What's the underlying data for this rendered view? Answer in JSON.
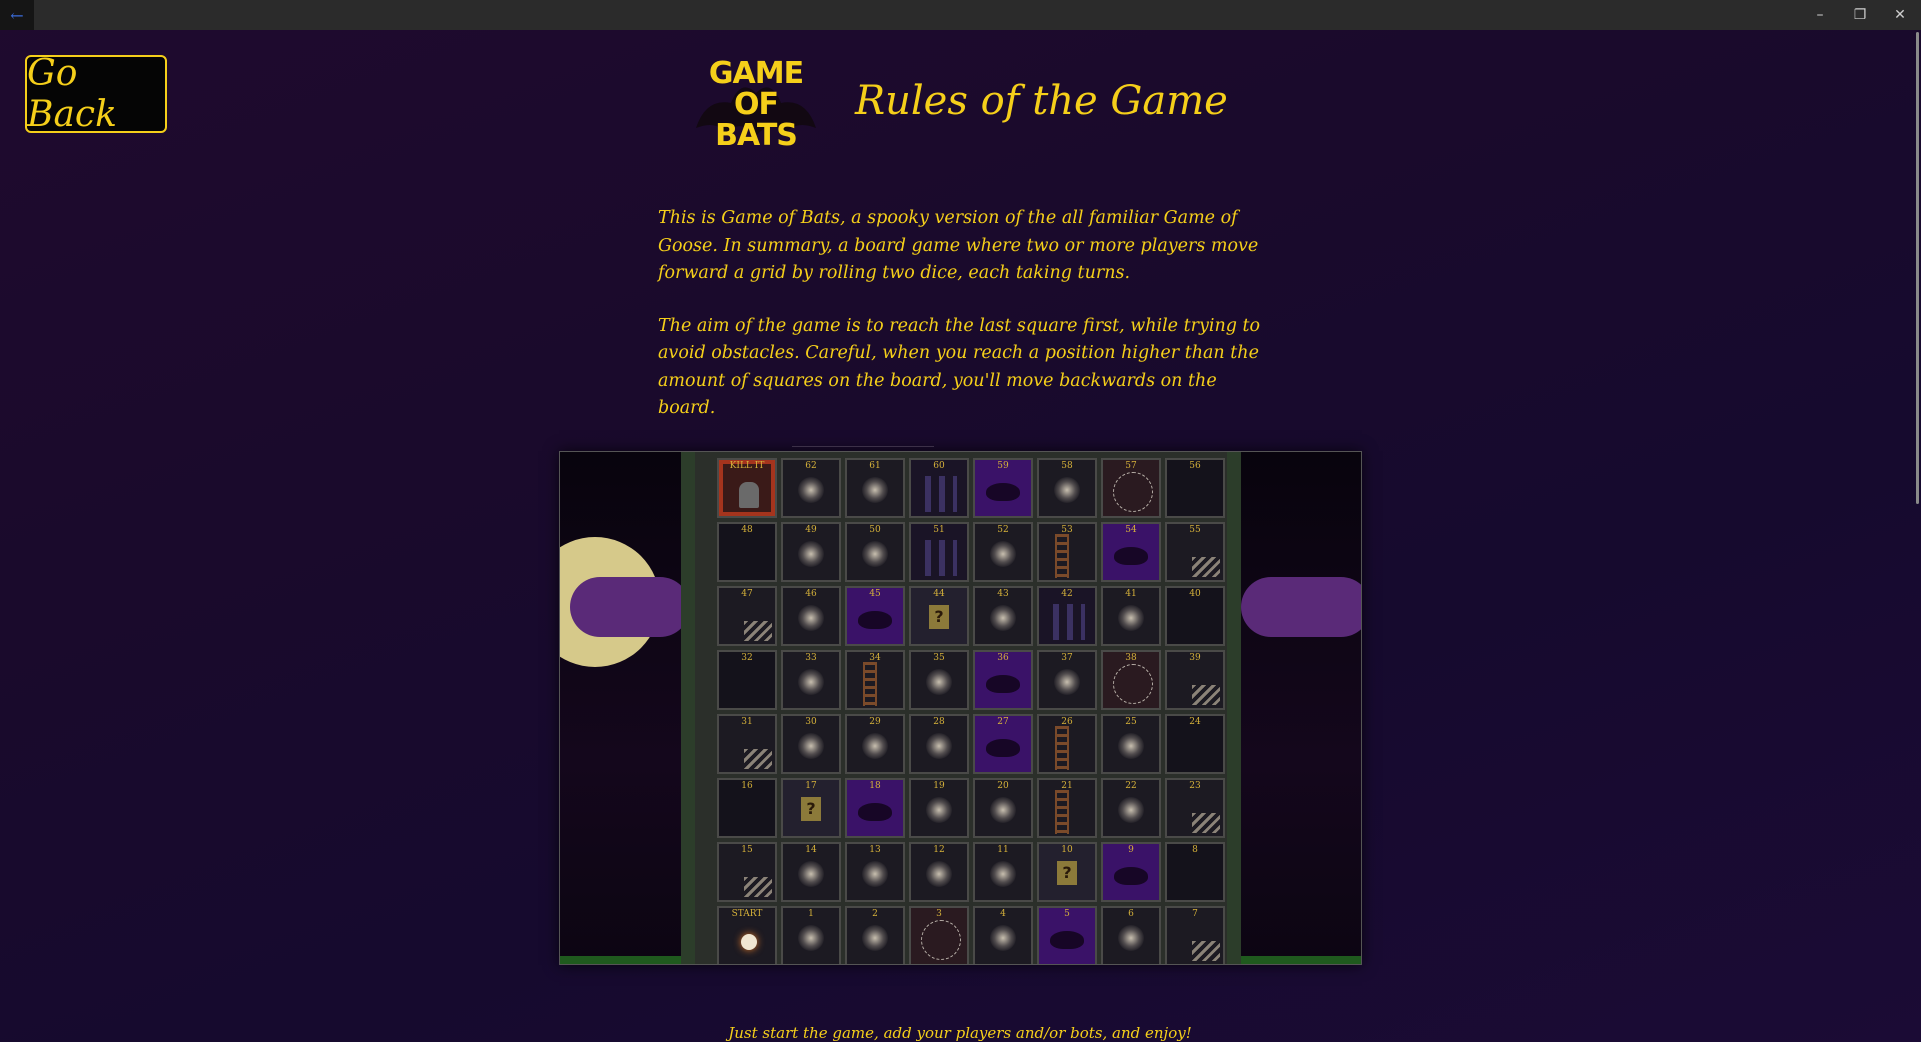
{
  "titlebar": {
    "back_glyph": "←",
    "minimize_glyph": "–",
    "restore_glyph": "❐",
    "close_glyph": "✕"
  },
  "go_back_label": "Go Back",
  "logo": {
    "line1": "GAME",
    "line2": "OF",
    "line3": "BATS"
  },
  "page_title": "Rules of the Game",
  "rules": {
    "paragraph1": "This is Game of Bats, a spooky version of the all familiar Game of Goose. In summary, a board game where two or more players move forward a grid by rolling two dice, each taking turns.",
    "paragraph2": "The aim of the game is to reach the last square first, while trying to avoid obstacles. Careful, when you reach a position higher than the amount of squares on the board, you'll move backwards on the board."
  },
  "board": {
    "rows": [
      [
        {
          "n": "KILL IT",
          "t": "kill"
        },
        {
          "n": "62",
          "t": "lamp"
        },
        {
          "n": "61",
          "t": "lamp"
        },
        {
          "n": "60",
          "t": "window"
        },
        {
          "n": "59",
          "t": "bat"
        },
        {
          "n": "58",
          "t": "lamp"
        },
        {
          "n": "57",
          "t": "web"
        },
        {
          "n": "56",
          "t": "dark"
        }
      ],
      [
        {
          "n": "48",
          "t": "dark"
        },
        {
          "n": "49",
          "t": "lamp"
        },
        {
          "n": "50",
          "t": "lamp"
        },
        {
          "n": "51",
          "t": "window"
        },
        {
          "n": "52",
          "t": "lamp"
        },
        {
          "n": "53",
          "t": "ladder"
        },
        {
          "n": "54",
          "t": "bat"
        },
        {
          "n": "55",
          "t": "stairs"
        }
      ],
      [
        {
          "n": "47",
          "t": "stairs"
        },
        {
          "n": "46",
          "t": "lamp"
        },
        {
          "n": "45",
          "t": "bat"
        },
        {
          "n": "44",
          "t": "question"
        },
        {
          "n": "43",
          "t": "lamp"
        },
        {
          "n": "42",
          "t": "window"
        },
        {
          "n": "41",
          "t": "lamp"
        },
        {
          "n": "40",
          "t": "dark"
        }
      ],
      [
        {
          "n": "32",
          "t": "dark"
        },
        {
          "n": "33",
          "t": "lamp"
        },
        {
          "n": "34",
          "t": "ladder"
        },
        {
          "n": "35",
          "t": "lamp"
        },
        {
          "n": "36",
          "t": "bat"
        },
        {
          "n": "37",
          "t": "lamp"
        },
        {
          "n": "38",
          "t": "web"
        },
        {
          "n": "39",
          "t": "stairs"
        }
      ],
      [
        {
          "n": "31",
          "t": "stairs"
        },
        {
          "n": "30",
          "t": "lamp"
        },
        {
          "n": "29",
          "t": "lamp"
        },
        {
          "n": "28",
          "t": "lamp"
        },
        {
          "n": "27",
          "t": "bat"
        },
        {
          "n": "26",
          "t": "ladder"
        },
        {
          "n": "25",
          "t": "lamp"
        },
        {
          "n": "24",
          "t": "dark"
        }
      ],
      [
        {
          "n": "16",
          "t": "dark"
        },
        {
          "n": "17",
          "t": "question"
        },
        {
          "n": "18",
          "t": "bat"
        },
        {
          "n": "19",
          "t": "lamp"
        },
        {
          "n": "20",
          "t": "lamp"
        },
        {
          "n": "21",
          "t": "ladder"
        },
        {
          "n": "22",
          "t": "lamp"
        },
        {
          "n": "23",
          "t": "stairs"
        }
      ],
      [
        {
          "n": "15",
          "t": "stairs"
        },
        {
          "n": "14",
          "t": "lamp"
        },
        {
          "n": "13",
          "t": "lamp"
        },
        {
          "n": "12",
          "t": "lamp"
        },
        {
          "n": "11",
          "t": "lamp"
        },
        {
          "n": "10",
          "t": "question"
        },
        {
          "n": "9",
          "t": "bat"
        },
        {
          "n": "8",
          "t": "dark"
        }
      ],
      [
        {
          "n": "START",
          "t": "start"
        },
        {
          "n": "1",
          "t": "lamp"
        },
        {
          "n": "2",
          "t": "lamp"
        },
        {
          "n": "3",
          "t": "web"
        },
        {
          "n": "4",
          "t": "lamp"
        },
        {
          "n": "5",
          "t": "bat"
        },
        {
          "n": "6",
          "t": "lamp"
        },
        {
          "n": "7",
          "t": "stairs"
        }
      ]
    ]
  },
  "footer_text": "Just start the game, add your players and/or bots, and enjoy!",
  "colors": {
    "accent_yellow": "#f5cf1a",
    "background_purple": "#1a0a2c",
    "bat_purple": "#3a1268"
  }
}
